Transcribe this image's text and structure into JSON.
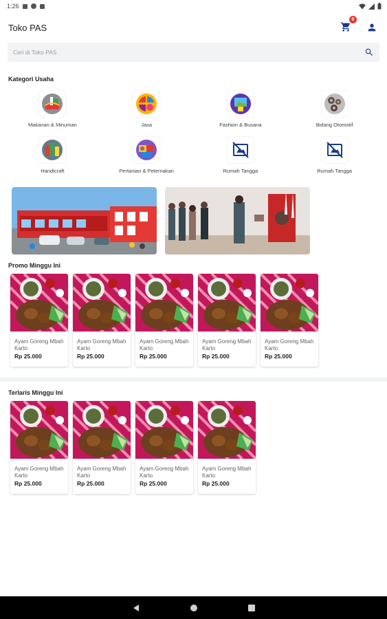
{
  "status_bar": {
    "time": "1:26"
  },
  "app_bar": {
    "title": "Toko PAS",
    "cart_count": "0"
  },
  "search": {
    "placeholder": "Cari di Toko PAS"
  },
  "categories": {
    "title": "Kategori Usaha",
    "items": [
      {
        "label": "Makanan & Minuman",
        "icon": "food-drink-icon"
      },
      {
        "label": "Jasa",
        "icon": "services-icon"
      },
      {
        "label": "Fashion & Busana",
        "icon": "fashion-icon"
      },
      {
        "label": "Bidang Otomotif",
        "icon": "automotive-icon"
      },
      {
        "label": "Handicraft",
        "icon": "handicraft-icon"
      },
      {
        "label": "Pertanian & Peternakan",
        "icon": "agriculture-icon"
      },
      {
        "label": "Rumah Tangga",
        "icon": "no-image-icon"
      },
      {
        "label": "Rumah Tangga",
        "icon": "no-image-icon"
      }
    ]
  },
  "promo": {
    "title": "Promo Minggu Ini",
    "items": [
      {
        "name": "Ayam Goreng Mbah Karto",
        "price": "Rp 25.000"
      },
      {
        "name": "Ayam Goreng Mbah Karto",
        "price": "Rp 25.000"
      },
      {
        "name": "Ayam Goreng Mbah Karto",
        "price": "Rp 25.000"
      },
      {
        "name": "Ayam Goreng Mbah Karto",
        "price": "Rp 25.000"
      },
      {
        "name": "Ayam Goreng Mbah Karto",
        "price": "Rp 25.000"
      }
    ]
  },
  "bestseller": {
    "title": "Terlaris Minggu Ini",
    "items": [
      {
        "name": "Ayam Goreng Mbah Karto",
        "price": "Rp 25.000"
      },
      {
        "name": "Ayam Goreng Mbah Karto",
        "price": "Rp 25.000"
      },
      {
        "name": "Ayam Goreng Mbah Karto",
        "price": "Rp 25.000"
      },
      {
        "name": "Ayam Goreng Mbah Karto",
        "price": "Rp 25.000"
      }
    ]
  },
  "colors": {
    "accent": "#1a3a8f",
    "badge": "#e53935"
  }
}
